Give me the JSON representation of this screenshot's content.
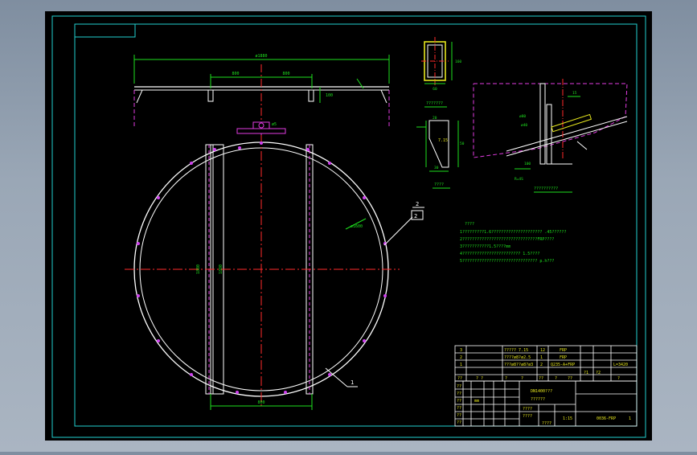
{
  "dims": {
    "overall_width": "ø1880",
    "span_left": "800",
    "span_right": "800",
    "bar_gap": "800",
    "vertical_1": "1880",
    "vertical_2": "1880",
    "small_h": "100",
    "pin_dia": "ø8",
    "ring_dia": "ø1600",
    "top_note": "ø5"
  },
  "details": {
    "section_a_caption": "???????",
    "section_b_caption": "????",
    "section_b_label": "7.15",
    "section_c_caption": "??????????",
    "section_c_label1": "ø80",
    "section_c_label2": "ø40",
    "section_c_label3": "100",
    "section_c_label4": "15",
    "section_c_label5": "R=4S",
    "sec_a_w": "60",
    "sec_a_h": "160",
    "sec_b_w": "20",
    "sec_b_h": "50",
    "sec_b_h2": "30"
  },
  "balloons": {
    "b1": "1",
    "b2": "2",
    "b2_box": "2"
  },
  "notes": {
    "title": "????",
    "lines": [
      "1?????????1.6????????????????????? .45??????",
      "2???????????????????????????????FRP????",
      "3???????????1.5????mm",
      "4???????????????????????? 1.5????",
      "5??????????????????????????????? p.h???"
    ]
  },
  "bom": {
    "rows": [
      {
        "no": "3",
        "name": "????? 7.15",
        "qty": "12",
        "mat": "FRP",
        "remark": ""
      },
      {
        "no": "2",
        "name": "????ø8?ø2.5",
        "qty": "1",
        "mat": "FRP",
        "remark": ""
      },
      {
        "no": "1",
        "name": "???ø8??ø8?ø3",
        "qty": "2",
        "mat": "Q235-A+FRP",
        "remark": "L=3420"
      }
    ],
    "header": [
      "??",
      "?  ?",
      "?",
      "?",
      "??",
      "?",
      "??",
      "?",
      "?"
    ],
    "header_small": [
      "?1",
      "?2"
    ]
  },
  "title_block": {
    "drawing_name_1": "DN1400???",
    "drawing_name_2": "??????",
    "scale_label": "????",
    "scale_value": "1:15",
    "sheet_label": "????",
    "weight_label": "????",
    "code": "0036-FRP",
    "page": "1",
    "small_labels": [
      "??",
      "??",
      "??",
      "??",
      "??",
      "mm",
      "??"
    ]
  },
  "colors": {
    "background": "#000000",
    "frame_cyan": "#22d0d0",
    "line_white": "#ffffff",
    "center_red": "#ff2a2a",
    "dim_green": "#1ee11e",
    "hidden_magenta": "#e23ce2",
    "node_magenta": "#d040f0",
    "text_yellow": "#e6e61e"
  }
}
